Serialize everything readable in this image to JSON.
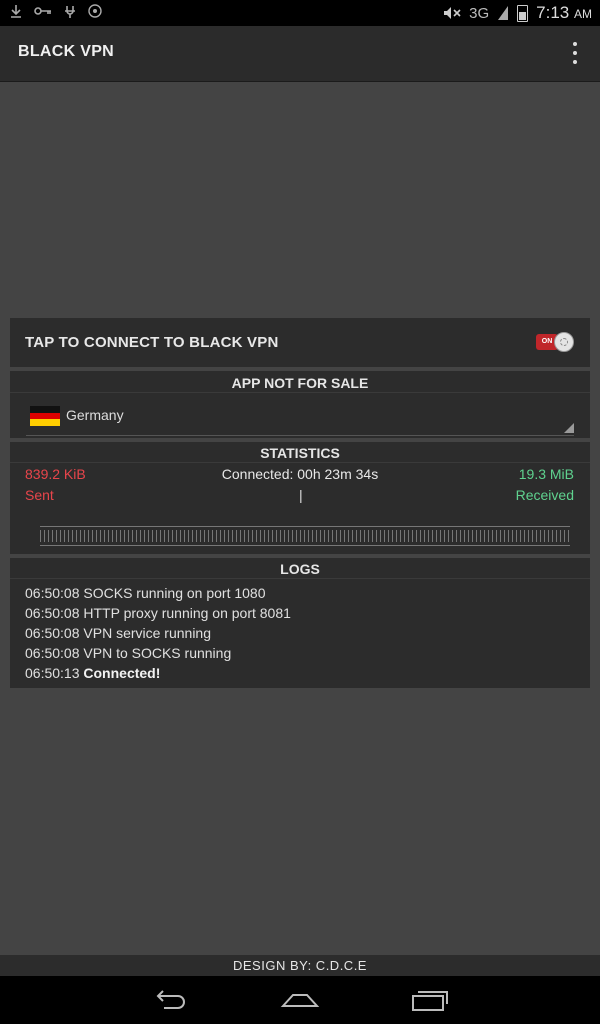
{
  "status_bar": {
    "network": "3G",
    "time": "7:13",
    "ampm": "AM",
    "left_icons": [
      "download-icon",
      "key-icon",
      "vpn-icon",
      "notification-icon"
    ],
    "right_icons": [
      "mute-icon",
      "signal-icon",
      "battery-icon"
    ]
  },
  "action_bar": {
    "title": "BLACK VPN",
    "overflow_icon": "overflow-menu-icon"
  },
  "connect": {
    "label": "TAP TO CONNECT TO BLACK VPN",
    "toggle_text": "ON",
    "toggle_color": "#c0262a"
  },
  "server": {
    "title": "APP NOT FOR SALE",
    "selected_country": "Germany",
    "flag_icon": "germany-flag-icon"
  },
  "statistics": {
    "title": "STATISTICS",
    "sent_value": "839.2 KiB",
    "sent_label": "Sent",
    "connected_time": "Connected: 00h 23m 34s",
    "cursor": "|",
    "received_value": "19.3 MiB",
    "received_label": "Received",
    "sent_color": "#e8454b",
    "received_color": "#5fd28f"
  },
  "logs": {
    "title": "LOGS",
    "entries": [
      {
        "time": "06:50:08",
        "message": "SOCKS running on port 1080"
      },
      {
        "time": "06:50:08",
        "message": "HTTP proxy running on port 8081"
      },
      {
        "time": "06:50:08",
        "message": "VPN service running"
      },
      {
        "time": "06:50:08",
        "message": "VPN to SOCKS running"
      },
      {
        "time": "06:50:13",
        "message": "Connected!"
      }
    ]
  },
  "footer": {
    "text": "DESIGN BY: C.D.C.E"
  },
  "nav": {
    "back_icon": "back-icon",
    "home_icon": "home-icon",
    "recents_icon": "recent-apps-icon"
  }
}
